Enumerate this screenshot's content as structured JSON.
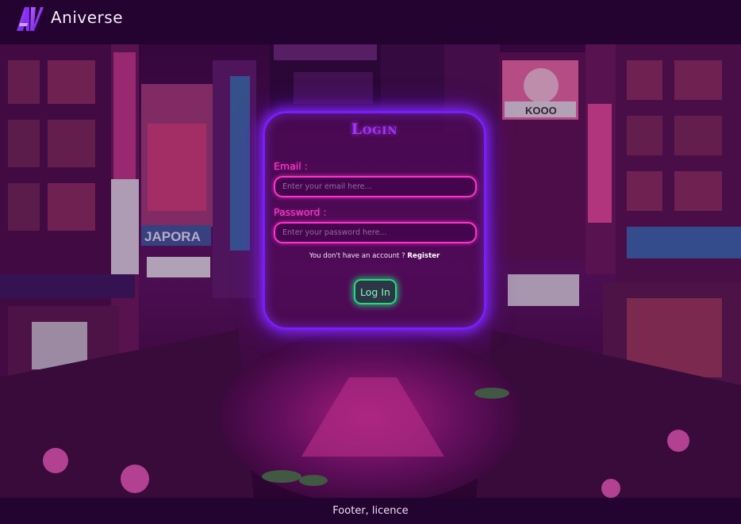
{
  "header": {
    "logo_text": "AV",
    "brand": "Aniverse"
  },
  "login": {
    "title": "Login",
    "email_label": "Email :",
    "email_placeholder": "Enter your email here...",
    "password_label": "Password :",
    "password_placeholder": "Enter your password here...",
    "register_prompt": "You don't have an account ? ",
    "register_link": "Register",
    "submit_label": "Log In"
  },
  "footer": {
    "text": "Footer, licence"
  },
  "colors": {
    "header_bg": "#250330",
    "card_border": "#7a1cff",
    "title": "#a233ff",
    "field_accent": "#ff33cc",
    "button_accent": "#1ee07a"
  },
  "background": {
    "description_icon": "neon-city-canal-background",
    "sign_texts": [
      "JAPORA",
      "KOOO"
    ]
  }
}
